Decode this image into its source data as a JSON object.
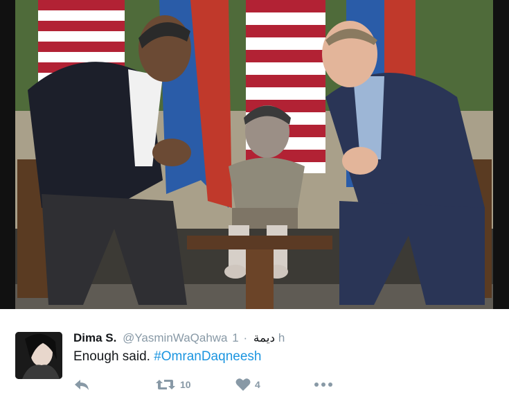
{
  "tweet": {
    "display_name": "Dima S.",
    "handle": "@YasminWaQahwa",
    "arabic_name": "ديمة",
    "separator": "·",
    "time": "1 h",
    "text_plain": "Enough said.",
    "hashtag": "#OmranDaqneesh",
    "retweet_count": "10",
    "like_count": "4"
  },
  "icons": {
    "reply": "reply-icon",
    "retweet": "retweet-icon",
    "like": "heart-icon",
    "more": "more-dots-icon"
  },
  "colors": {
    "text": "#14171a",
    "muted": "#8899a6",
    "hashtag": "#1b95e0"
  }
}
